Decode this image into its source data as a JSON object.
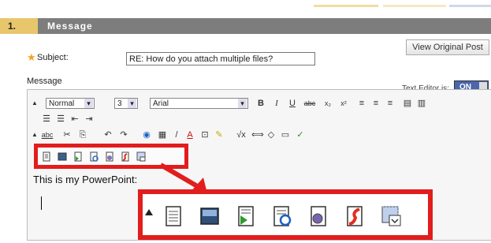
{
  "step": {
    "number": "1.",
    "title": "Message"
  },
  "view_original_button": "View Original Post",
  "subject": {
    "label": "Subject:",
    "value": "RE: How do you attach multiple files?"
  },
  "message_label": "Message",
  "text_editor": {
    "label": "Text Editor is:",
    "state": "ON"
  },
  "toolbar": {
    "format_select": "Normal",
    "size_select": "3",
    "font_select": "Arial",
    "bold": "B",
    "italic": "I",
    "underline": "U",
    "strike": "abc",
    "subscript": "x₂",
    "superscript": "x²",
    "spellcheck": "abc",
    "formula": "√x"
  },
  "content": {
    "text": "This is my PowerPoint:"
  },
  "colors": {
    "highlight": "#e21d1d",
    "step_bar": "#7d7d7d",
    "step_number_bg": "#e8c66b",
    "editor_toggle": "#4a66ad"
  },
  "attachment_icons": [
    "insert-file-icon",
    "insert-image-icon",
    "insert-mashup-icon",
    "insert-media-icon",
    "insert-audio-icon",
    "insert-flash-icon",
    "insert-web-content-icon"
  ]
}
